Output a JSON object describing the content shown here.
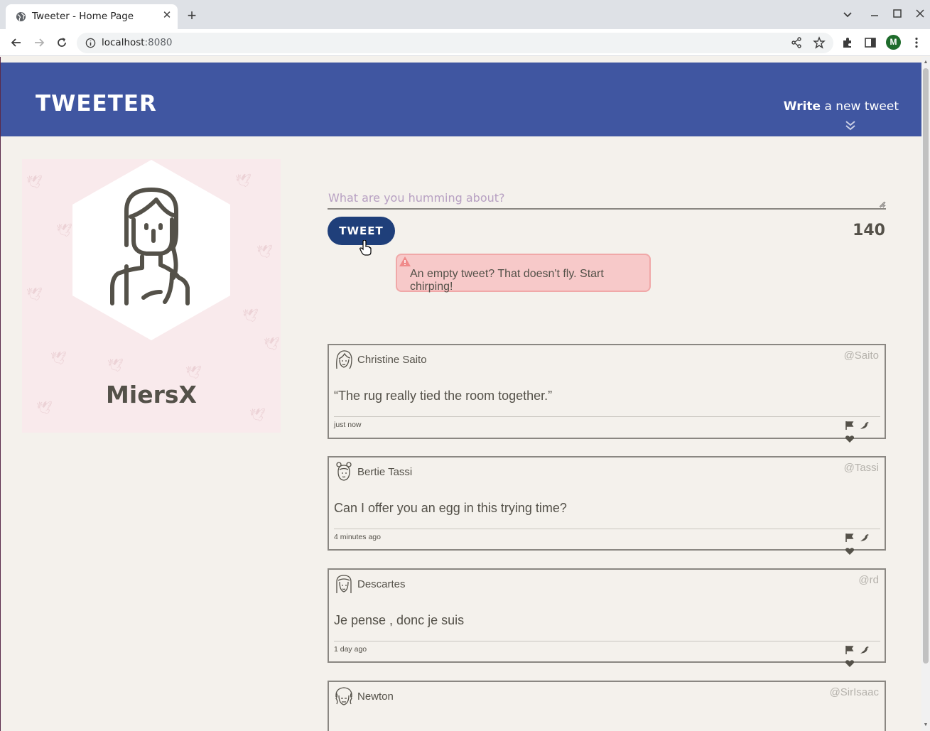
{
  "browser": {
    "tab_title": "Tweeter - Home Page",
    "url_host": "localhost",
    "url_port": ":8080",
    "profile_initial": "M"
  },
  "nav": {
    "logo": "Tweeter",
    "write_bold": "Write",
    "write_rest": " a new tweet"
  },
  "profile": {
    "name": "MiersX"
  },
  "composer": {
    "placeholder": "What are you humming about?",
    "button_label": "Tweet",
    "counter": "140",
    "error": "An empty tweet? That doesn't fly. Start chirping!"
  },
  "tweets": [
    {
      "name": "Christine Saito",
      "handle": "@Saito",
      "body": "“The rug really tied the room together.”",
      "time": "just now"
    },
    {
      "name": "Bertie Tassi",
      "handle": "@Tassi",
      "body": "Can I offer you an egg in this trying time?",
      "time": "4 minutes ago"
    },
    {
      "name": "Descartes",
      "handle": "@rd",
      "body": "Je pense , donc je suis",
      "time": "1 day ago"
    },
    {
      "name": "Newton",
      "handle": "@SirIsaac",
      "body": "",
      "time": ""
    }
  ],
  "colors": {
    "nav_bg": "#4056a1",
    "page_bg": "#f4f1ec",
    "button_bg": "#1f3f7a",
    "error_bg": "#f7c9c9"
  }
}
